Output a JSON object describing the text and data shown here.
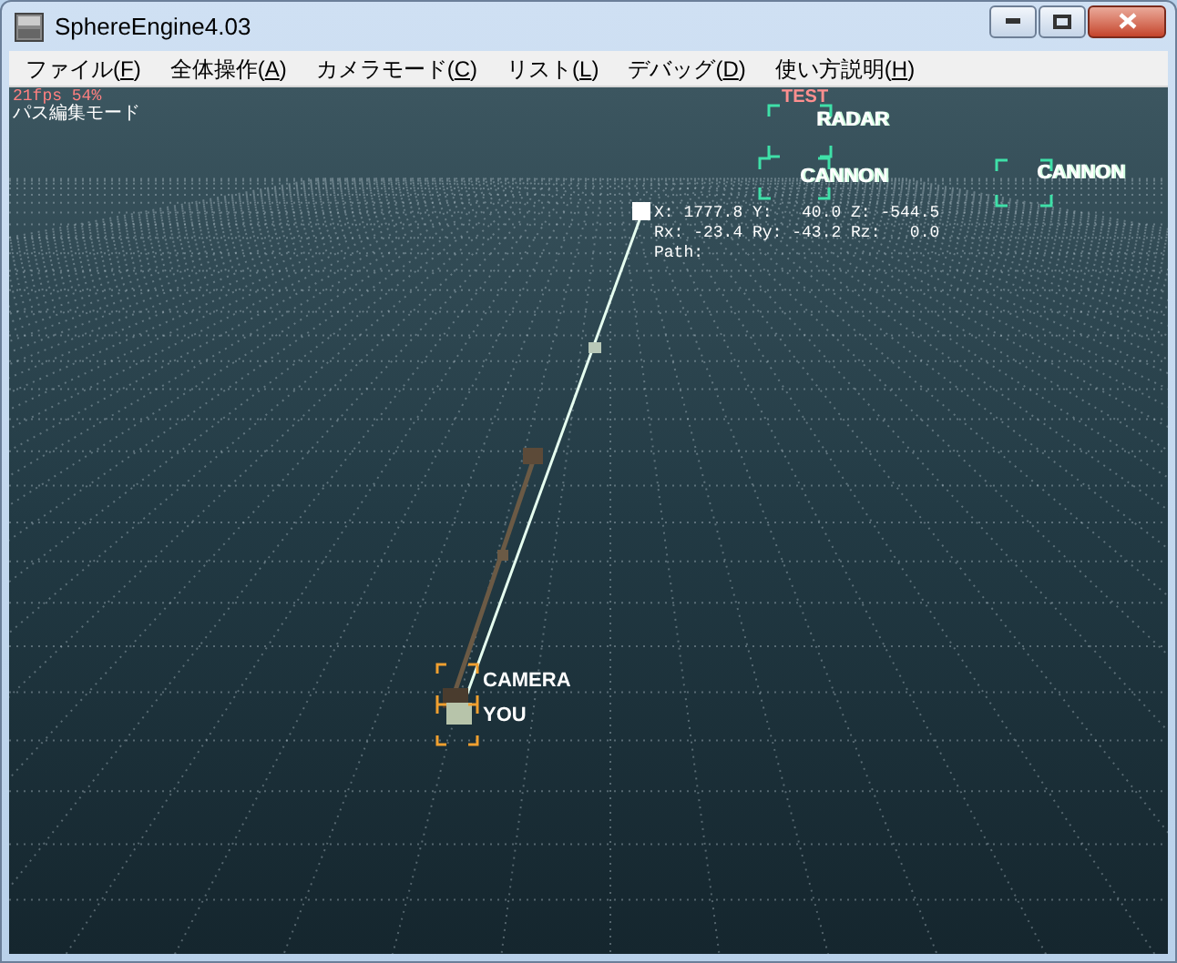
{
  "window": {
    "title": "SphereEngine4.03"
  },
  "menu": [
    {
      "label": "ファイル(F)"
    },
    {
      "label": "全体操作(A)"
    },
    {
      "label": "カメラモード(C)"
    },
    {
      "label": "リスト(L)"
    },
    {
      "label": "デバッグ(D)"
    },
    {
      "label": "使い方説明(H)"
    }
  ],
  "hud": {
    "stats": "21fps  54%",
    "mode": "パス編集モード",
    "coords": [
      "X: 1777.8 Y:   40.0 Z: -544.5",
      "Rx: -23.4 Ry: -43.2 Rz:   0.0",
      "Path:"
    ]
  },
  "objects": [
    {
      "label": "TEST",
      "kind": "warning"
    },
    {
      "label": "RADAR",
      "kind": "target"
    },
    {
      "label": "CANNON",
      "kind": "target"
    },
    {
      "label": "CANNON",
      "kind": "target"
    },
    {
      "label": "CAMERA",
      "kind": "path"
    },
    {
      "label": "YOU",
      "kind": "path"
    }
  ]
}
